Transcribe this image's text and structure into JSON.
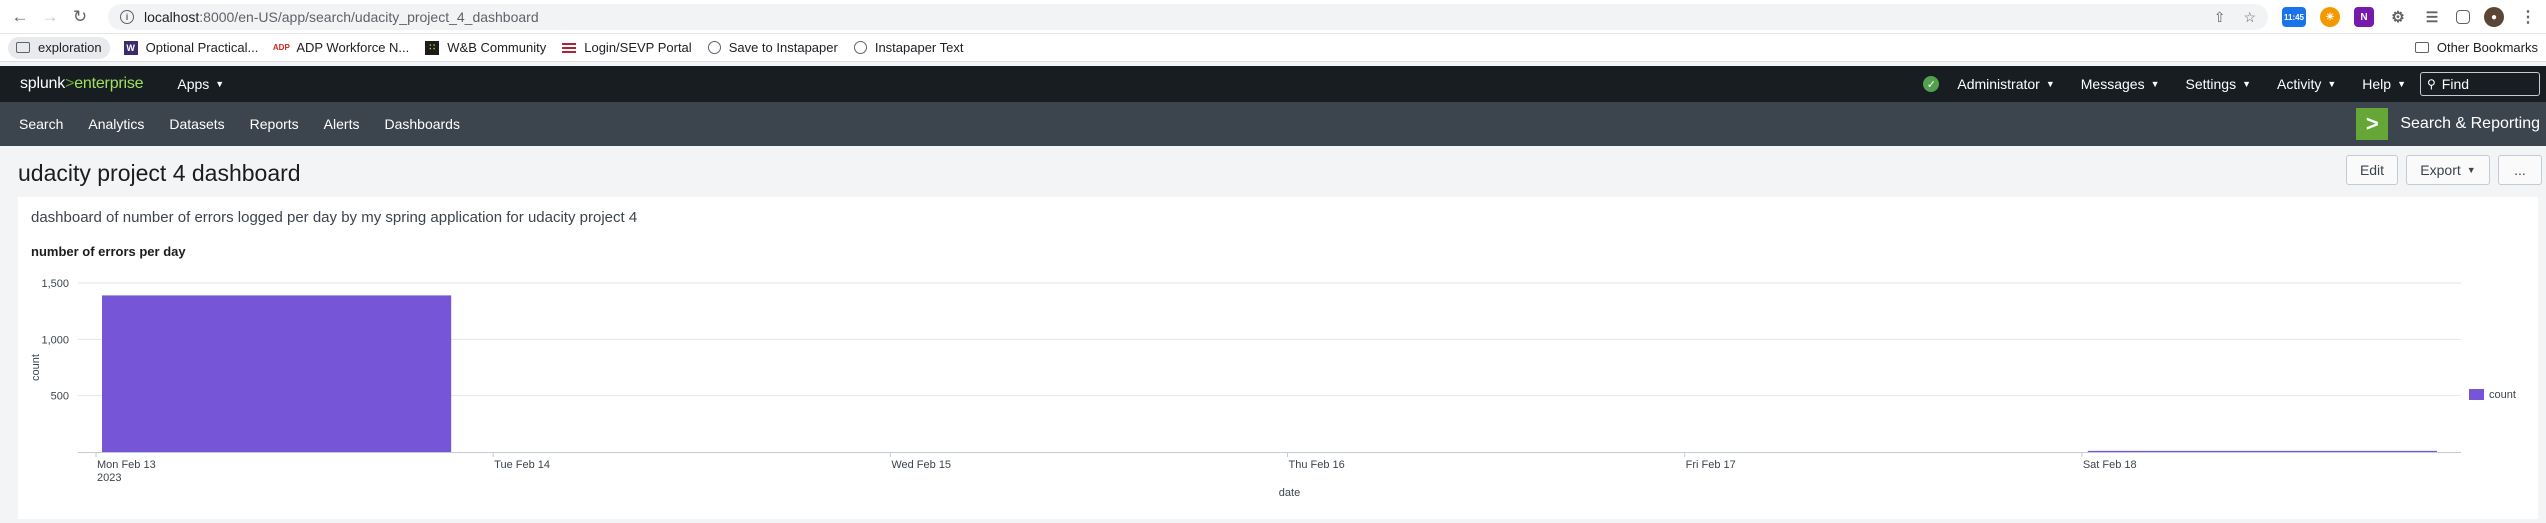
{
  "browser": {
    "url_host": "localhost",
    "url_path": ":8000/en-US/app/search/udacity_project_4_dashboard",
    "extension_badge": "11:45",
    "bookmarks": [
      {
        "label": "exploration",
        "icon": "folder-icon"
      },
      {
        "label": "Optional Practical...",
        "icon": "w-icon"
      },
      {
        "label": "ADP Workforce N...",
        "icon": "adp-icon"
      },
      {
        "label": "W&B Community",
        "icon": "wandb-icon"
      },
      {
        "label": "Login/SEVP Portal",
        "icon": "flag-icon"
      },
      {
        "label": "Save to Instapaper",
        "icon": "globe-icon"
      },
      {
        "label": "Instapaper Text",
        "icon": "globe-icon"
      }
    ],
    "other_bookmarks": "Other Bookmarks"
  },
  "splunk": {
    "logo_left": "splunk",
    "logo_gt": ">",
    "logo_right": "enterprise",
    "apps_label": "Apps",
    "top_menus": [
      "Administrator",
      "Messages",
      "Settings",
      "Activity",
      "Help"
    ],
    "find_placeholder": "Find",
    "app_nav": [
      "Search",
      "Analytics",
      "Datasets",
      "Reports",
      "Alerts",
      "Dashboards"
    ],
    "app_name": "Search & Reporting"
  },
  "dashboard": {
    "title": "udacity project 4 dashboard",
    "edit_label": "Edit",
    "export_label": "Export",
    "more_label": "...",
    "description": "dashboard of number of errors logged per day by my spring application for udacity project 4",
    "panel_title": "number of errors per day"
  },
  "chart_data": {
    "type": "bar",
    "x": [
      "2023-02-13",
      "2023-02-14",
      "2023-02-15",
      "2023-02-16",
      "2023-02-17",
      "2023-02-18"
    ],
    "tick_labels": [
      "Mon Feb 13",
      "Tue Feb 14",
      "Wed Feb 15",
      "Thu Feb 16",
      "Fri Feb 17",
      "Sat Feb 18"
    ],
    "tick_sublabel": "2023",
    "series": [
      {
        "name": "count",
        "values": [
          1390,
          0,
          0,
          0,
          0,
          10
        ],
        "color": "#7655d6"
      }
    ],
    "xlabel": "date",
    "ylabel": "count",
    "ylim": [
      0,
      1500
    ],
    "yticks": [
      500,
      1000,
      1500
    ],
    "ytick_labels": [
      "500",
      "1,000",
      "1,500"
    ],
    "grid": true,
    "legend": "right"
  }
}
